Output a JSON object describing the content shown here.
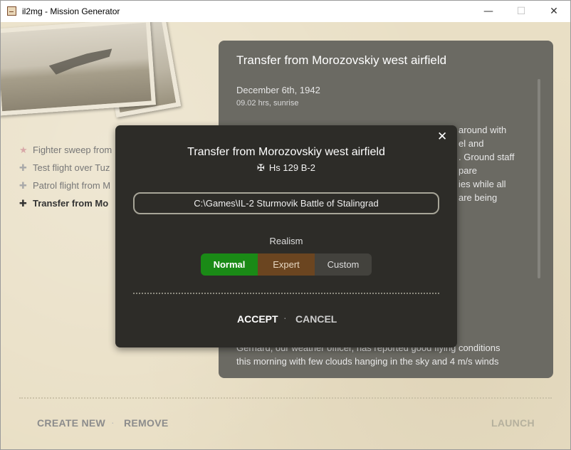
{
  "window": {
    "title": "il2mg - Mission Generator",
    "minimize_glyph": "—",
    "maximize_glyph": "☐",
    "close_glyph": "✕"
  },
  "missions": [
    {
      "label": "Fighter sweep from",
      "icon": "star-icon",
      "glyph": "★",
      "active": false
    },
    {
      "label": "Test flight over Tuz",
      "icon": "cross-icon",
      "glyph": "✚",
      "active": false
    },
    {
      "label": "Patrol flight from M",
      "icon": "cross-icon",
      "glyph": "✚",
      "active": false
    },
    {
      "label": "Transfer from Mo",
      "icon": "cross-icon",
      "glyph": "✚",
      "active": true
    }
  ],
  "footer": {
    "create_label": "CREATE NEW",
    "remove_label": "REMOVE",
    "launch_label": "LAUNCH",
    "separator": "·"
  },
  "briefing": {
    "title": "Transfer from Morozovskiy west airfield",
    "date": "December 6th, 1942",
    "time": "09.02 hrs, sunrise",
    "partial_lines": [
      "around with",
      "el and",
      ". Ground staff",
      "pare",
      "ies while all",
      "are being"
    ],
    "bottom_lines": [
      "Gerhard, our weather officer, has reported good flying conditions",
      "this morning with few clouds hanging in the sky and 4 m/s winds"
    ]
  },
  "modal": {
    "close_glyph": "✕",
    "title": "Transfer from Morozovskiy west airfield",
    "aircraft_glyph": "✠",
    "aircraft": "Hs 129 B-2",
    "path_value": "C:\\Games\\IL-2 Sturmovik Battle of Stalingrad",
    "realism_label": "Realism",
    "realism_options": [
      "Normal",
      "Expert",
      "Custom"
    ],
    "realism_selected": "Normal",
    "accept_label": "ACCEPT",
    "cancel_label": "CANCEL",
    "separator": "·"
  },
  "colors": {
    "normal": "#1a8a16",
    "expert": "#6b4520",
    "custom": "#43423d",
    "panel": "#6b6a63",
    "modal": "#2d2c28"
  }
}
